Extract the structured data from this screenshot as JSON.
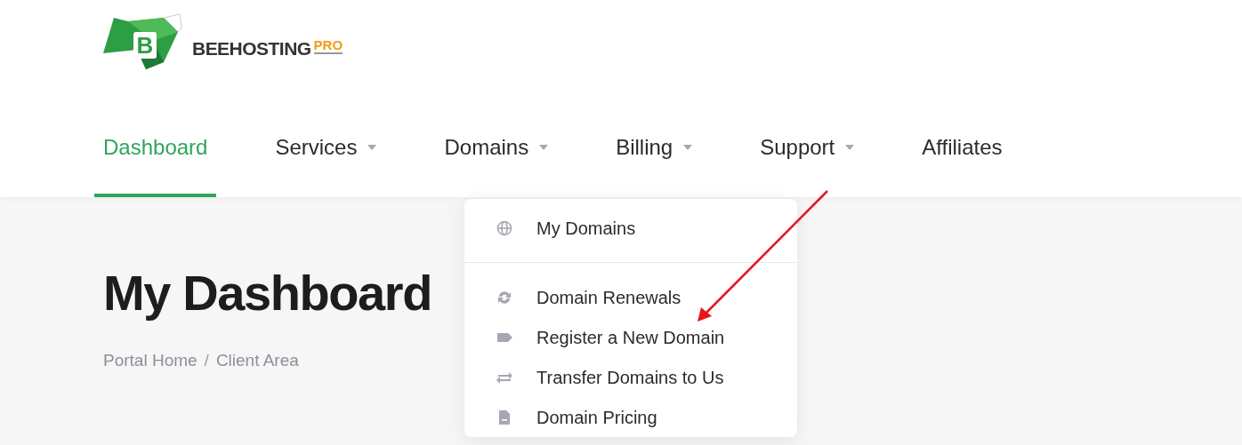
{
  "logo": {
    "mark": "B",
    "name": "BEEHOSTING",
    "tier": "PRO"
  },
  "nav": [
    {
      "label": "Dashboard",
      "selected": true,
      "dropdown": false
    },
    {
      "label": "Services",
      "selected": false,
      "dropdown": true
    },
    {
      "label": "Domains",
      "selected": false,
      "dropdown": true
    },
    {
      "label": "Billing",
      "selected": false,
      "dropdown": true
    },
    {
      "label": "Support",
      "selected": false,
      "dropdown": true
    },
    {
      "label": "Affiliates",
      "selected": false,
      "dropdown": false
    }
  ],
  "dropdown_menu": {
    "sections": [
      {
        "items": [
          {
            "label": "My Domains"
          }
        ]
      },
      {
        "items": [
          {
            "label": "Domain Renewals"
          },
          {
            "label": "Register a New Domain"
          },
          {
            "label": "Transfer Domains to Us"
          },
          {
            "label": "Domain Pricing"
          }
        ]
      }
    ]
  },
  "page": {
    "title": "My Dashboard",
    "breadcrumb": [
      "Portal Home",
      "Client Area"
    ],
    "breadcrumb_separator": "/"
  }
}
